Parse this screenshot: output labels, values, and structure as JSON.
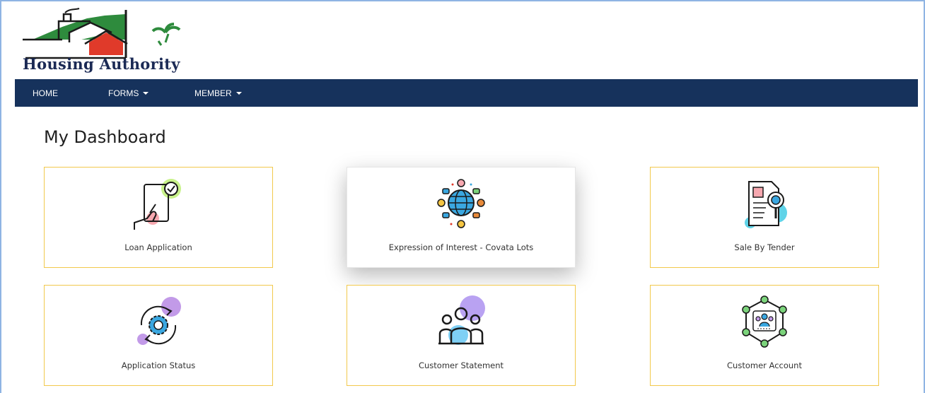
{
  "brand": {
    "name": "Housing Authority",
    "logo_icon": "housing-logo-icon"
  },
  "nav": {
    "home": "HOME",
    "forms": "FORMS",
    "member": "MEMBER"
  },
  "page": {
    "title": "My Dashboard"
  },
  "cards": [
    {
      "label": "Loan Application",
      "icon": "tablet-check-icon"
    },
    {
      "label": "Expression of Interest - Covata Lots",
      "icon": "globe-network-icon"
    },
    {
      "label": "Sale By Tender",
      "icon": "document-search-icon"
    },
    {
      "label": "Application Status",
      "icon": "refresh-gear-icon"
    },
    {
      "label": "Customer Statement",
      "icon": "group-people-icon"
    },
    {
      "label": "Customer Account",
      "icon": "network-users-icon"
    }
  ],
  "colors": {
    "navbar": "#16325c",
    "card_border": "#f2c94c",
    "logo_red": "#e03a2a",
    "logo_green": "#2e8b3d"
  }
}
